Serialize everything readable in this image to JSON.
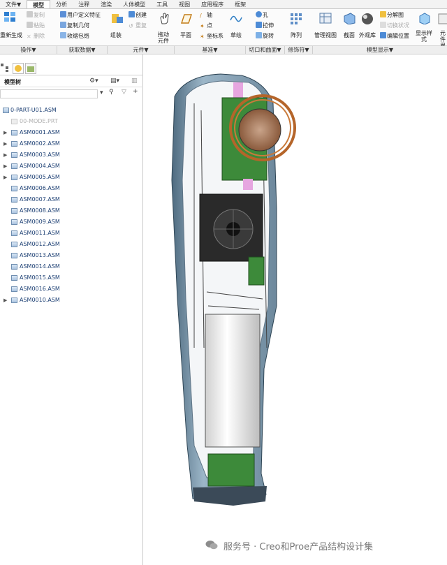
{
  "menu": {
    "tabs": [
      "文件▼",
      "模型",
      "分析",
      "注释",
      "渲染",
      "人体模型",
      "工具",
      "视图",
      "应用程序",
      "框架"
    ],
    "active_index": 1
  },
  "ribbon": {
    "regenerate": "重新生成",
    "copy": "复制",
    "paste": "粘贴",
    "delete": "删除",
    "udf": "用户定义特征",
    "copy_geometry": "复制几何",
    "shrinkwrap": "收缩包络",
    "assemble": "组装",
    "create": "创建",
    "repeat": "重复",
    "drag_components": "拖动元件",
    "plane": "平面",
    "axis": "轴",
    "point": "点",
    "csys": "坐标系",
    "sketch": "草绘",
    "hole": "孔",
    "extrude": "拉伸",
    "revolve": "旋转",
    "pattern": "阵列",
    "manage_views": "管理视图",
    "section": "截面",
    "appearance": "外观库",
    "exploded_view": "分解图",
    "toggle_status": "切换状况",
    "edit_position": "编辑位置",
    "display_style": "显示样式",
    "component_interface": "元件界面"
  },
  "ribbon_groups": [
    "操作▼",
    "获取数据▼",
    "元件▼",
    "基准▼",
    "切口和曲面▼",
    "修饰符▼",
    "模型显示▼"
  ],
  "model_tree": {
    "title": "模型树",
    "root": "0-PART-U01.ASM",
    "items": [
      {
        "label": "00-MODE.PRT",
        "expandable": false,
        "dim": true
      },
      {
        "label": "ASM0001.ASM",
        "expandable": true,
        "dim": false
      },
      {
        "label": "ASM0002.ASM",
        "expandable": true,
        "dim": false
      },
      {
        "label": "ASM0003.ASM",
        "expandable": true,
        "dim": false
      },
      {
        "label": "ASM0004.ASM",
        "expandable": true,
        "dim": false
      },
      {
        "label": "ASM0005.ASM",
        "expandable": true,
        "dim": false
      },
      {
        "label": "ASM0006.ASM",
        "expandable": false,
        "dim": false
      },
      {
        "label": "ASM0007.ASM",
        "expandable": false,
        "dim": false
      },
      {
        "label": "ASM0008.ASM",
        "expandable": false,
        "dim": false
      },
      {
        "label": "ASM0009.ASM",
        "expandable": false,
        "dim": false
      },
      {
        "label": "ASM0011.ASM",
        "expandable": false,
        "dim": false
      },
      {
        "label": "ASM0012.ASM",
        "expandable": false,
        "dim": false
      },
      {
        "label": "ASM0013.ASM",
        "expandable": false,
        "dim": false
      },
      {
        "label": "ASM0014.ASM",
        "expandable": false,
        "dim": false
      },
      {
        "label": "ASM0015.ASM",
        "expandable": false,
        "dim": false
      },
      {
        "label": "ASM0016.ASM",
        "expandable": false,
        "dim": false
      },
      {
        "label": "ASM0010.ASM",
        "expandable": true,
        "dim": false
      }
    ]
  },
  "watermark": "服务号 · Creo和Proe产品结构设计集",
  "colors": {
    "body_shell": "#8aa4b8",
    "pcb_green": "#3d8a3a",
    "copper_coil": "#b5652a",
    "battery": "#f2f2f2",
    "tree_text": "#1c3f73"
  }
}
